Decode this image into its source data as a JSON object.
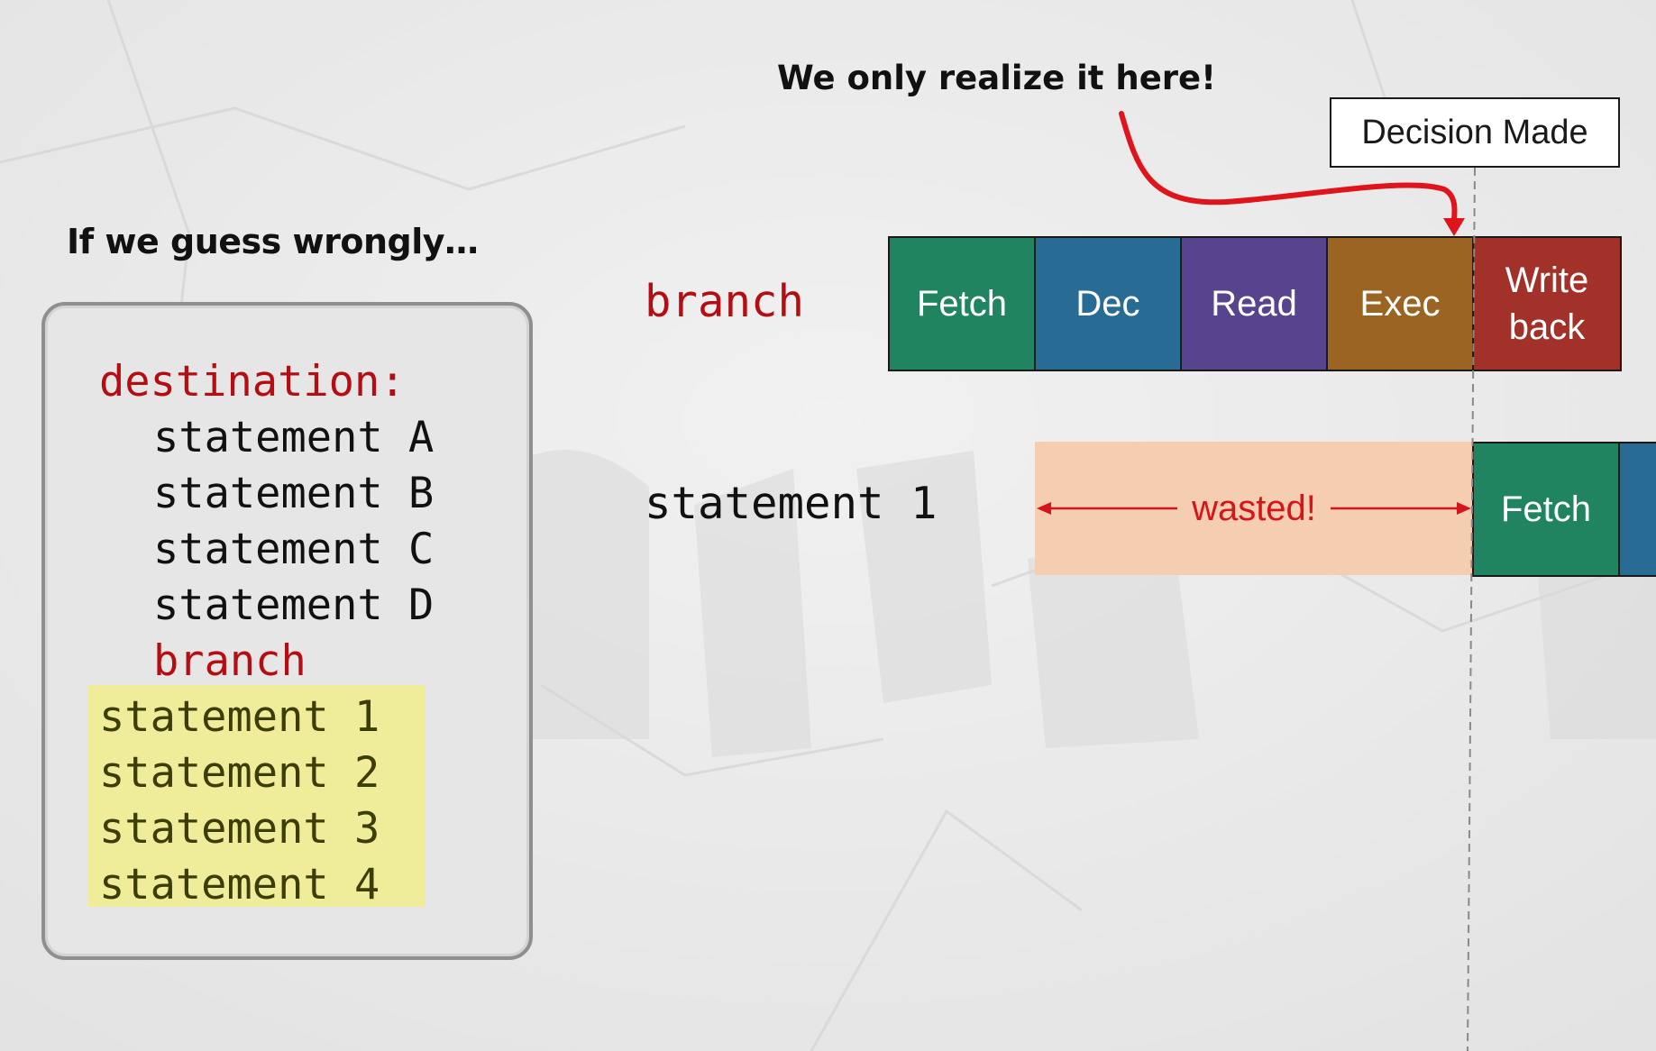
{
  "annotation": "We only realize it here!",
  "decision_label": "Decision Made",
  "intro_text": "If we guess wrongly…",
  "code": {
    "destination_label": "destination:",
    "statements_before": [
      "statement A",
      "statement B",
      "statement C",
      "statement D"
    ],
    "branch_label": "branch",
    "statements_after": [
      "statement 1",
      "statement 2",
      "statement 3",
      "statement 4"
    ]
  },
  "pipeline": {
    "branch_row_label": "branch",
    "stmt_row_label": "statement 1",
    "stages": [
      {
        "label": "Fetch",
        "color": "#218460"
      },
      {
        "label": "Dec",
        "color": "#286c96"
      },
      {
        "label": "Read",
        "color": "#57438e"
      },
      {
        "label": "Exec",
        "color": "#9b6423"
      },
      {
        "label": "Write\nback",
        "color": "#a2312a"
      }
    ],
    "wasted_label": "wasted!",
    "next_stages": [
      {
        "label": "Fetch",
        "color": "#218460"
      },
      {
        "label": "",
        "color": "#286c96"
      }
    ]
  },
  "colors": {
    "red": "#b40d12",
    "arrow_red": "#e0151b",
    "wasted_fill": "#f5cdb0",
    "highlight_fill": "#f0ed9a"
  }
}
